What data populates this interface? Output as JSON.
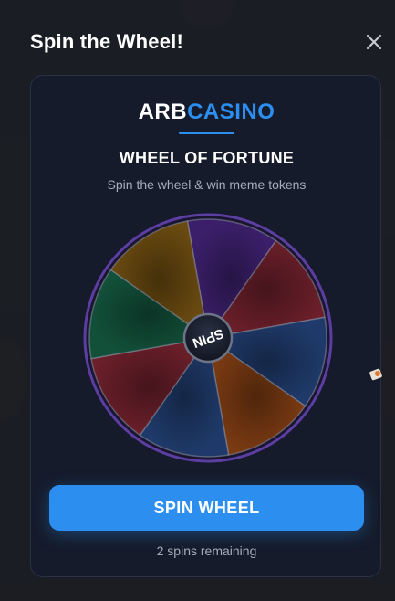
{
  "modal": {
    "title": "Spin the Wheel!",
    "close_icon": "close-icon"
  },
  "brand": {
    "part1": "ARB",
    "part2": "CASINO",
    "accent_color": "#2c8ff0"
  },
  "heading": "WHEEL OF FORTUNE",
  "subheading": "Spin the wheel & win meme tokens",
  "wheel": {
    "center_label": "SPIN",
    "segments": [
      {
        "color": "#3b1f6a"
      },
      {
        "color": "#6b1f2a"
      },
      {
        "color": "#1f3a6a"
      },
      {
        "color": "#7a3a12"
      },
      {
        "color": "#1f3a6a"
      },
      {
        "color": "#6b1f2a"
      },
      {
        "color": "#12503a"
      },
      {
        "color": "#6a4a10"
      }
    ],
    "rim_color": "#5b3fa0"
  },
  "spin_button_label": "SPIN WHEEL",
  "spins_remaining": "2 spins remaining"
}
